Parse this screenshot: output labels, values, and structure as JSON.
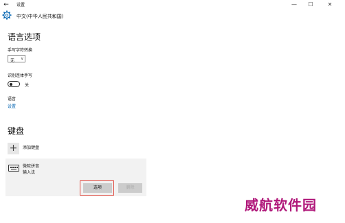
{
  "window": {
    "title": "设置",
    "back_glyph": "←",
    "minimize_glyph": "—",
    "maximize_glyph": "☐",
    "close_glyph": "✕"
  },
  "header": {
    "icon": "gear-icon",
    "title": "中文(中华人民共和国)"
  },
  "language_options": {
    "heading": "语言选项",
    "handwriting_convert": {
      "label": "手写字符转换",
      "selected": "无",
      "chevron": "∨"
    },
    "recognize_cursive": {
      "label": "识别连体手写",
      "state": "关",
      "on": false
    },
    "speech": {
      "label": "语音",
      "link": "设置"
    }
  },
  "keyboards": {
    "heading": "键盘",
    "add": {
      "glyph": "+",
      "label": "添加键盘"
    },
    "items": [
      {
        "name": "微软拼音",
        "desc": "输入法",
        "options_label": "选项",
        "delete_label": "删除"
      }
    ]
  },
  "watermark": "威航软件园",
  "colors": {
    "accent_link": "#0063b1",
    "highlight": "#e0443a",
    "watermark": "#b0187a"
  }
}
